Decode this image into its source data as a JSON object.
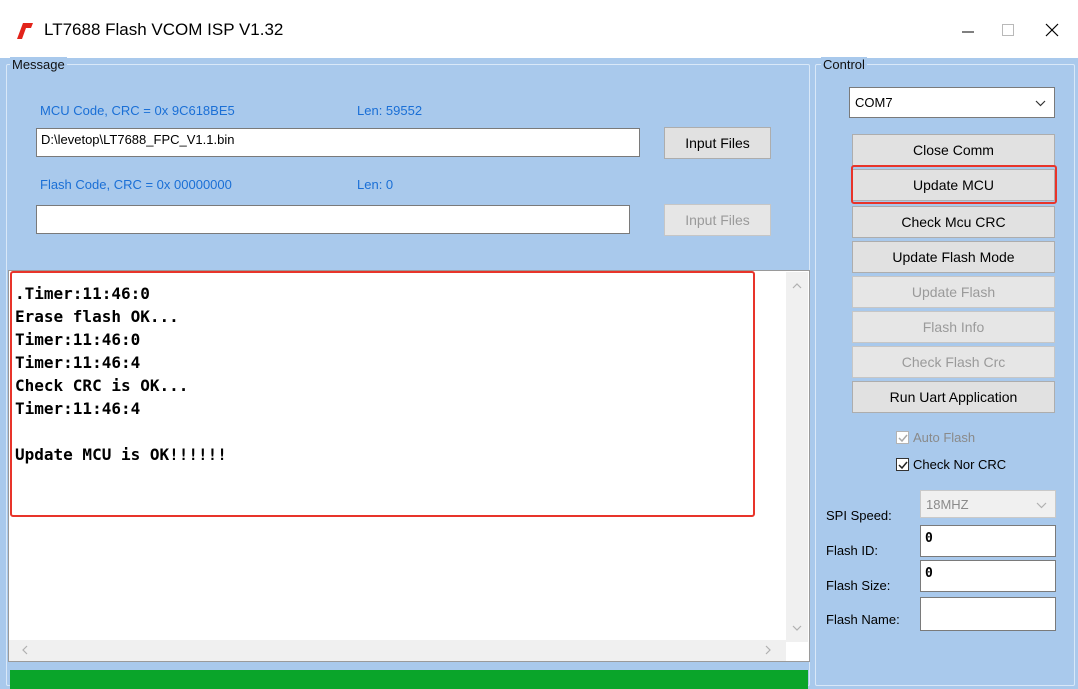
{
  "window": {
    "title": "LT7688 Flash VCOM ISP V1.32",
    "logo_icon": "red-leaf-logo",
    "minimize_icon": "minimize-icon",
    "maximize_icon": "maximize-icon",
    "close_icon": "close-icon"
  },
  "message": {
    "group_label": "Message",
    "mcu_crc_label": "MCU Code, CRC = 0x 9C618BE5",
    "mcu_len_label": "Len:  59552",
    "mcu_path": "D:\\levetop\\LT7688_FPC_V1.1.bin",
    "mcu_input_button": "Input Files",
    "flash_crc_label": "Flash Code, CRC = 0x 00000000",
    "flash_len_label": "Len:  0",
    "flash_path": "",
    "flash_input_button": "Input Files",
    "log_lines": [
      ".Timer:11:46:0",
      "Erase flash OK...",
      "Timer:11:46:0",
      "Timer:11:46:4",
      "Check CRC is OK...",
      "Timer:11:46:4",
      "",
      "Update MCU is OK!!!!!!"
    ],
    "progress": 1.0
  },
  "control": {
    "group_label": "Control",
    "com_port": "COM7",
    "buttons": {
      "close_comm": "Close Comm",
      "update_mcu": "Update MCU",
      "check_mcu_crc": "Check Mcu CRC",
      "update_flash_mode": "Update Flash Mode",
      "update_flash": "Update Flash",
      "flash_info": "Flash Info",
      "check_flash_crc": "Check Flash Crc",
      "run_uart_application": "Run Uart Application"
    },
    "auto_flash_label": "Auto Flash",
    "auto_flash_checked": true,
    "check_nor_crc_label": "Check Nor CRC",
    "check_nor_crc_checked": true,
    "spi_speed_label": "SPI Speed:",
    "spi_speed_value": "18MHZ",
    "flash_id_label": "Flash ID:",
    "flash_id_value": "0",
    "flash_size_label": "Flash Size:",
    "flash_size_value": "0",
    "flash_name_label": "Flash Name:",
    "flash_name_value": ""
  },
  "colors": {
    "client_bg": "#a9c9ec",
    "label_blue": "#1a6fd6",
    "highlight_red": "#e8342a",
    "progress_green": "#0aa52a"
  }
}
